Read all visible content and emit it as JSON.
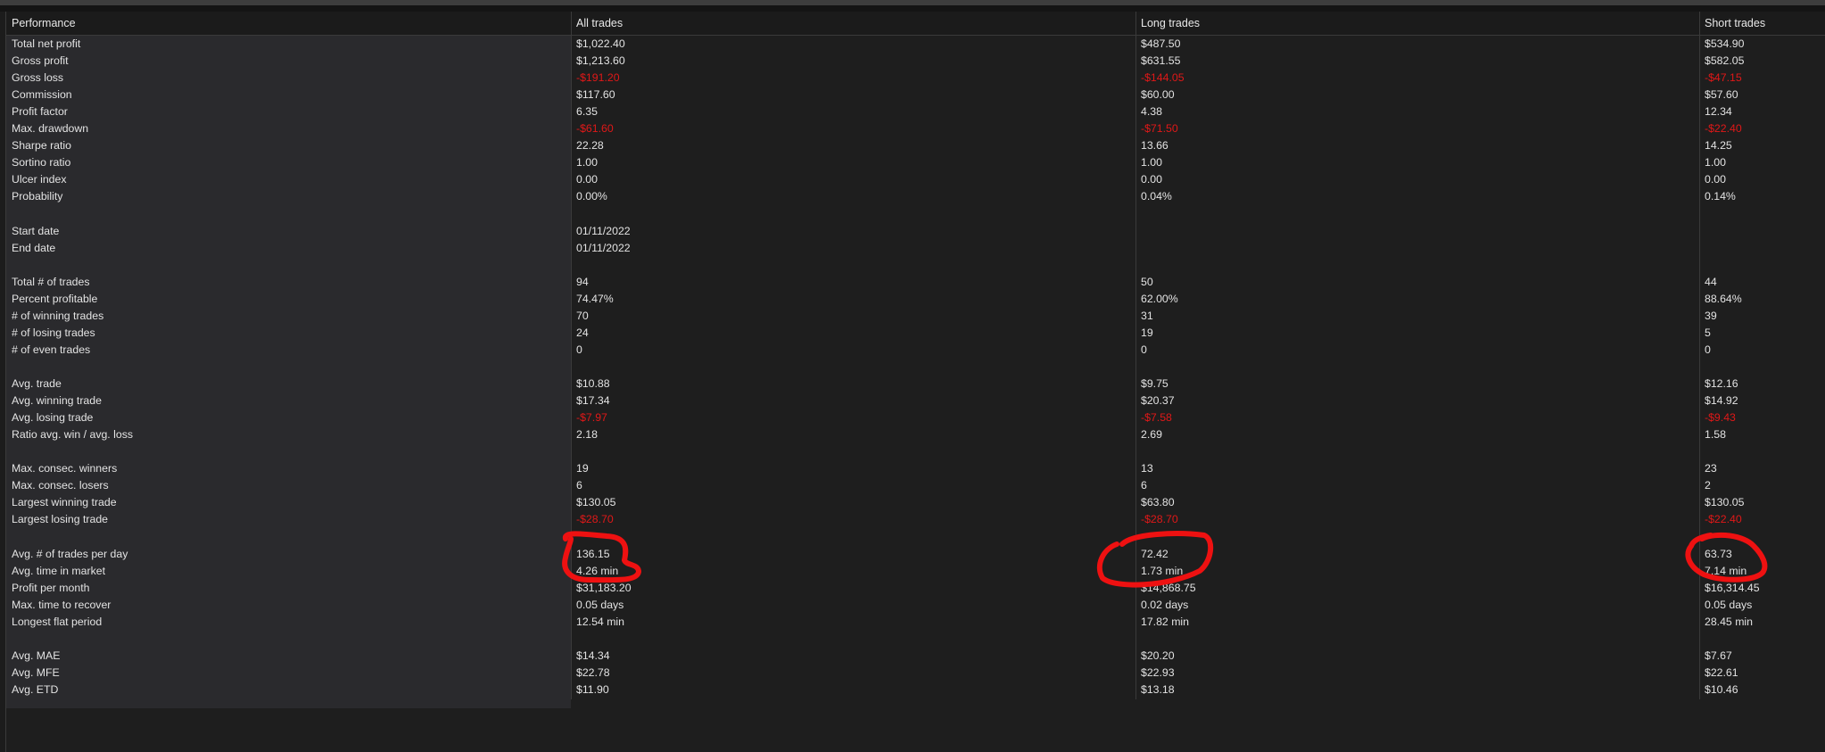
{
  "columns": [
    "Performance",
    "All trades",
    "Long trades",
    "Short trades"
  ],
  "colors": {
    "negative": "#e01818",
    "annotation": "#ee1111"
  },
  "annotation": {
    "description_icon": "red-circle-annotation"
  },
  "rows": [
    {
      "label": "Total net profit",
      "all": "$1,022.40",
      "long": "$487.50",
      "short": "$534.90"
    },
    {
      "label": "Gross profit",
      "all": "$1,213.60",
      "long": "$631.55",
      "short": "$582.05"
    },
    {
      "label": "Gross loss",
      "all": "-$191.20",
      "long": "-$144.05",
      "short": "-$47.15",
      "negative": true
    },
    {
      "label": "Commission",
      "all": "$117.60",
      "long": "$60.00",
      "short": "$57.60"
    },
    {
      "label": "Profit factor",
      "all": "6.35",
      "long": "4.38",
      "short": "12.34"
    },
    {
      "label": "Max. drawdown",
      "all": "-$61.60",
      "long": "-$71.50",
      "short": "-$22.40",
      "negative": true
    },
    {
      "label": "Sharpe ratio",
      "all": "22.28",
      "long": "13.66",
      "short": "14.25"
    },
    {
      "label": "Sortino ratio",
      "all": "1.00",
      "long": "1.00",
      "short": "1.00"
    },
    {
      "label": "Ulcer index",
      "all": "0.00",
      "long": "0.00",
      "short": "0.00"
    },
    {
      "label": "Probability",
      "all": "0.00%",
      "long": "0.04%",
      "short": "0.14%"
    },
    {
      "label": "",
      "all": "",
      "long": "",
      "short": ""
    },
    {
      "label": "Start date",
      "all": "01/11/2022",
      "long": "",
      "short": ""
    },
    {
      "label": "End date",
      "all": "01/11/2022",
      "long": "",
      "short": ""
    },
    {
      "label": "",
      "all": "",
      "long": "",
      "short": ""
    },
    {
      "label": "Total # of trades",
      "all": "94",
      "long": "50",
      "short": "44"
    },
    {
      "label": "Percent profitable",
      "all": "74.47%",
      "long": "62.00%",
      "short": "88.64%"
    },
    {
      "label": "# of winning trades",
      "all": "70",
      "long": "31",
      "short": "39"
    },
    {
      "label": "# of losing trades",
      "all": "24",
      "long": "19",
      "short": "5"
    },
    {
      "label": "# of even trades",
      "all": "0",
      "long": "0",
      "short": "0"
    },
    {
      "label": "",
      "all": "",
      "long": "",
      "short": ""
    },
    {
      "label": "Avg. trade",
      "all": "$10.88",
      "long": "$9.75",
      "short": "$12.16"
    },
    {
      "label": "Avg. winning trade",
      "all": "$17.34",
      "long": "$20.37",
      "short": "$14.92"
    },
    {
      "label": "Avg. losing trade",
      "all": "-$7.97",
      "long": "-$7.58",
      "short": "-$9.43",
      "negative": true
    },
    {
      "label": "Ratio avg. win / avg. loss",
      "all": "2.18",
      "long": "2.69",
      "short": "1.58"
    },
    {
      "label": "",
      "all": "",
      "long": "",
      "short": ""
    },
    {
      "label": "Max. consec. winners",
      "all": "19",
      "long": "13",
      "short": "23"
    },
    {
      "label": "Max. consec. losers",
      "all": "6",
      "long": "6",
      "short": "2"
    },
    {
      "label": "Largest winning trade",
      "all": "$130.05",
      "long": "$63.80",
      "short": "$130.05"
    },
    {
      "label": "Largest losing trade",
      "all": "-$28.70",
      "long": "-$28.70",
      "short": "-$22.40",
      "negative": true
    },
    {
      "label": "",
      "all": "",
      "long": "",
      "short": ""
    },
    {
      "label": "Avg. # of trades per day",
      "all": "136.15",
      "long": "72.42",
      "short": "63.73"
    },
    {
      "label": "Avg. time in market",
      "all": "4.26 min",
      "long": "1.73 min",
      "short": "7.14 min"
    },
    {
      "label": "Profit per month",
      "all": "$31,183.20",
      "long": "$14,868.75",
      "short": "$16,314.45"
    },
    {
      "label": "Max. time to recover",
      "all": "0.05 days",
      "long": "0.02 days",
      "short": "0.05 days"
    },
    {
      "label": "Longest flat period",
      "all": "12.54 min",
      "long": "17.82 min",
      "short": "28.45 min"
    },
    {
      "label": "",
      "all": "",
      "long": "",
      "short": ""
    },
    {
      "label": "Avg. MAE",
      "all": "$14.34",
      "long": "$20.20",
      "short": "$7.67"
    },
    {
      "label": "Avg. MFE",
      "all": "$22.78",
      "long": "$22.93",
      "short": "$22.61"
    },
    {
      "label": "Avg. ETD",
      "all": "$11.90",
      "long": "$13.18",
      "short": "$10.46"
    }
  ]
}
